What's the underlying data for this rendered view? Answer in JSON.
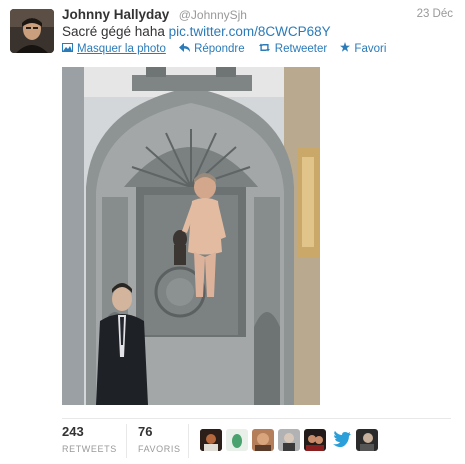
{
  "tweet": {
    "fullname": "Johnny Hallyday",
    "screen_name": "@JohnnySjh",
    "date": "23 Déc",
    "text": "Sacré gégé haha",
    "link": "pic.twitter.com/8CWCP68Y"
  },
  "actions": {
    "hide_photo": "Masquer la photo",
    "reply": "Répondre",
    "retweet": "Retweeter",
    "favorite": "Favori"
  },
  "stats": {
    "retweets_count": "243",
    "retweets_label": "RETWEETS",
    "favorites_count": "76",
    "favorites_label": "FAVORIS"
  },
  "icons": {
    "avatar": "profile-photo",
    "hide": "photo-icon",
    "reply": "reply-arrow-icon",
    "retweet": "retweet-icon",
    "favorite": "star-icon",
    "bird": "twitter-bird-icon"
  },
  "colors": {
    "link": "#2b7bb9",
    "text": "#333333",
    "muted": "#999999"
  }
}
